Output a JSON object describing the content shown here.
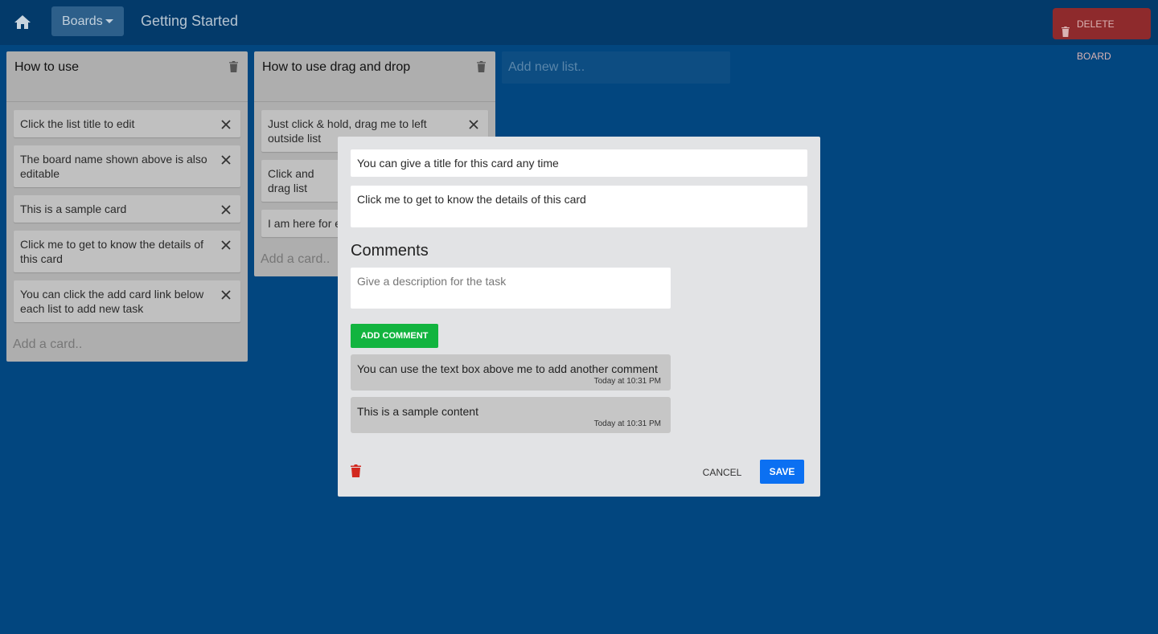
{
  "header": {
    "boards_label": "Boards",
    "board_title": "Getting Started",
    "delete_board_label": "DELETE BOARD"
  },
  "lists": [
    {
      "title": "How to use",
      "cards": [
        "Click the list title to edit",
        "The board name shown above is also editable",
        "This is a sample card",
        "Click me to get to know the details of this card",
        "You can click the add card link below each list to add new task"
      ],
      "add_card_label": "Add a card.."
    },
    {
      "title": "How to use drag and drop",
      "cards": [
        "Just click & hold, drag me to left outside list",
        "Click and drag list",
        "I am here for e"
      ],
      "add_card_label": "Add a card.."
    }
  ],
  "add_list_placeholder": "Add new list..",
  "modal": {
    "card_title": "You can give a title for this card any time",
    "card_description": "Click me to get to know the details of this card",
    "comments_heading": "Comments",
    "comment_placeholder": "Give a description for the task",
    "add_comment_label": "ADD COMMENT",
    "comments": [
      {
        "text": "You can use the text box above me to add another comment",
        "time": "Today at 10:31 PM"
      },
      {
        "text": "This is a sample content",
        "time": "Today at 10:31 PM"
      }
    ],
    "cancel_label": "CANCEL",
    "save_label": "SAVE"
  },
  "colors": {
    "background": "#02467f",
    "topbar": "#033a6a",
    "delete": "#8e2a2c",
    "add_comment": "#12b43f",
    "save": "#0b70f2",
    "trash_red": "#d2281f"
  },
  "icons": [
    "home-icon",
    "chevron-down-icon",
    "trash-icon",
    "close-icon"
  ]
}
